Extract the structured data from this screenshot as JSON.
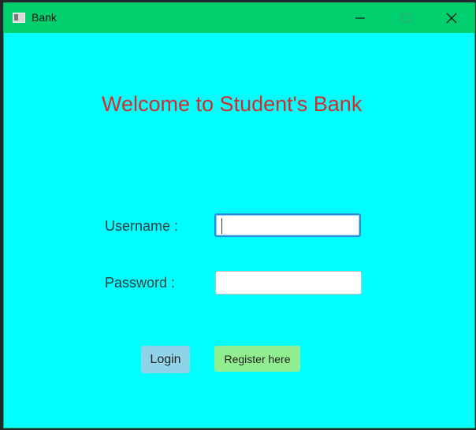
{
  "window": {
    "title": "Bank",
    "titlebar_color": "#00cf6e",
    "background_color": "#00ffff",
    "controls": [
      "minimize-icon",
      "maximize-icon",
      "close-icon"
    ]
  },
  "main": {
    "heading": "Welcome to Student's Bank",
    "heading_color": "#d12d2d",
    "username_label": "Username :",
    "password_label": "Password :",
    "username_value": "",
    "password_value": "",
    "login_label": "Login",
    "register_label": "Register here",
    "login_color": "#8fd3e9",
    "register_color": "#90ee90"
  }
}
